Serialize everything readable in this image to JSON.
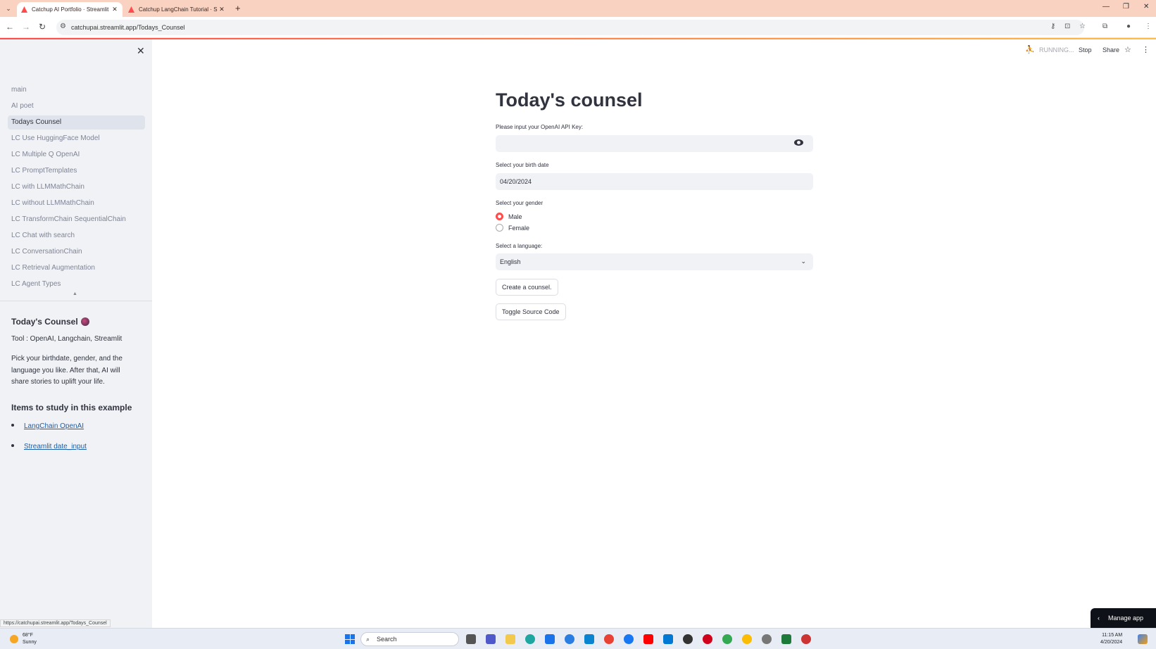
{
  "browser": {
    "tabs": [
      {
        "label": "Catchup AI Portfolio · Streamlit",
        "active": true
      },
      {
        "label": "Catchup LangChain Tutorial · S",
        "active": false
      }
    ],
    "url": "catchupai.streamlit.app/Todays_Counsel",
    "status_url": "https://catchupai.streamlit.app/Todays_Counsel"
  },
  "sidebar": {
    "nav_items": [
      {
        "label": "main",
        "active": false
      },
      {
        "label": "AI poet",
        "active": false
      },
      {
        "label": "Todays Counsel",
        "active": true
      },
      {
        "label": "LC Use HuggingFace Model",
        "active": false
      },
      {
        "label": "LC Multiple Q OpenAI",
        "active": false
      },
      {
        "label": "LC PromptTemplates",
        "active": false
      },
      {
        "label": "LC with LLMMathChain",
        "active": false
      },
      {
        "label": "LC without LLMMathChain",
        "active": false
      },
      {
        "label": "LC TransformChain SequentialChain",
        "active": false
      },
      {
        "label": "LC Chat with search",
        "active": false
      },
      {
        "label": "LC ConversationChain",
        "active": false
      },
      {
        "label": "LC Retrieval Augmentation",
        "active": false
      },
      {
        "label": "LC Agent Types",
        "active": false
      }
    ],
    "info_title": "Today's Counsel",
    "tool_line": "Tool : OpenAI, Langchain, Streamlit",
    "description": "Pick your birthdate, gender, and the language you like. After that, AI will share stories to uplift your life.",
    "study_heading": "Items to study in this example",
    "study_links": [
      "LangChain OpenAI",
      "Streamlit date_input"
    ]
  },
  "toolbar": {
    "running": "RUNNING...",
    "stop": "Stop",
    "share": "Share"
  },
  "main": {
    "title": "Today's counsel",
    "api_key_label": "Please input your OpenAI API Key:",
    "api_key_value": "",
    "birth_label": "Select your birth date",
    "birth_value": "04/20/2024",
    "gender_label": "Select your gender",
    "gender_options": [
      "Male",
      "Female"
    ],
    "gender_selected": "Male",
    "language_label": "Select a language:",
    "language_value": "English",
    "create_button": "Create a counsel.",
    "toggle_button": "Toggle Source Code"
  },
  "manage_app": "Manage app",
  "taskbar": {
    "temperature": "68°F",
    "weather": "Sunny",
    "search_placeholder": "Search",
    "time": "11:15 AM",
    "date": "4/20/2024"
  },
  "colors": {
    "accent": "#ff4b4b",
    "sidebar_bg": "#f0f2f6",
    "tabstrip_bg": "#f9d2c1",
    "link": "#1f5ea8"
  }
}
